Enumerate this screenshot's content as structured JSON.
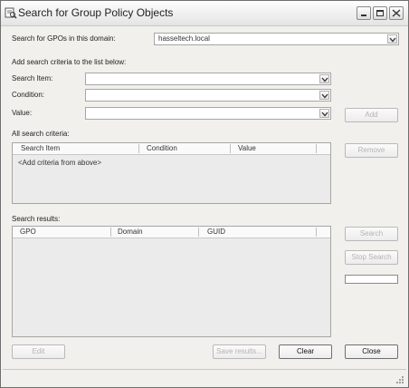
{
  "window": {
    "title": "Search for Group Policy Objects"
  },
  "domain_label": "Search for GPOs in this domain:",
  "domain_value": "hasseltech.local",
  "criteria": {
    "intro": "Add search criteria to the list below:",
    "search_item_label": "Search Item:",
    "condition_label": "Condition:",
    "value_label": "Value:",
    "add_button": "Add"
  },
  "all_criteria": {
    "label": "All search criteria:",
    "columns": [
      "Search Item",
      "Condition",
      "Value"
    ],
    "placeholder_row": "<Add criteria from above>",
    "remove_button": "Remove"
  },
  "results": {
    "label": "Search results:",
    "columns": [
      "GPO",
      "Domain",
      "GUID"
    ],
    "search_button": "Search",
    "stop_button": "Stop Search",
    "progress": 0
  },
  "footer": {
    "edit_button": "Edit",
    "save_button": "Save results...",
    "clear_button": "Clear",
    "close_button": "Close"
  }
}
